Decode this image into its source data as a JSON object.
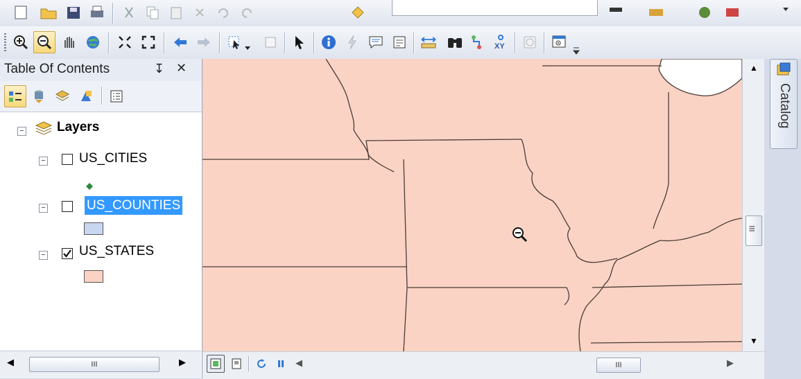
{
  "toc": {
    "title": "Table Of Contents",
    "pin_glyph": "↧",
    "close_glyph": "✕",
    "root_label": "Layers",
    "layers": [
      {
        "name": "US_CITIES",
        "checked": false,
        "symbol": "point",
        "color": "#2b8a3e"
      },
      {
        "name": "US_COUNTIES",
        "checked": false,
        "symbol": "polygon",
        "color": "#c9d6ef",
        "selected": true
      },
      {
        "name": "US_STATES",
        "checked": true,
        "symbol": "polygon",
        "color": "#fad3c5"
      }
    ],
    "hscroll_thumb": "III"
  },
  "map": {
    "fill_color": "#fad3c5",
    "hscroll_thumb": "III",
    "vscroll_thumb": "III"
  },
  "catalog": {
    "label": "Catalog"
  },
  "colors": {
    "active_tool": "#f7d97c",
    "selection": "#3399ff",
    "border_lines": "#4a3b36"
  }
}
